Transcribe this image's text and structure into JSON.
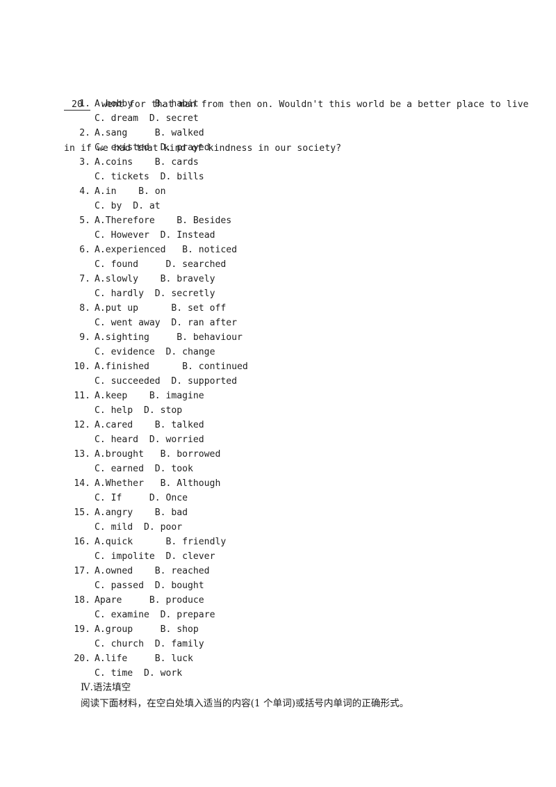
{
  "document": {
    "page_background": "#ffffff",
    "text_color": "#1d1d1d"
  },
  "passage": {
    "blank_number": "20",
    "line1_after_blank": "  went for that man from then on. Wouldn't this world be a better place to live",
    "line2": "in if we had that kind of kindness in our society?"
  },
  "cloze": {
    "items": [
      {
        "num": "1.",
        "a": "A.hobby",
        "b": "B. habit",
        "gap_ab": "    ",
        "c": "C. dream",
        "d": "D. secret",
        "gap_cd": "  ",
        "c_indent": "  "
      },
      {
        "num": "2.",
        "a": "A.sang",
        "b": "B. walked",
        "gap_ab": "     ",
        "c": "C. existed",
        "d": "D. prayed",
        "gap_cd": "  ",
        "c_indent": "  "
      },
      {
        "num": "3.",
        "a": "A.coins",
        "b": "B. cards",
        "gap_ab": "    ",
        "c": "C. tickets",
        "d": "D. bills",
        "gap_cd": "  ",
        "c_indent": "  "
      },
      {
        "num": "4.",
        "a": "A.in",
        "b": "B. on",
        "gap_ab": "    ",
        "c": "C. by",
        "d": "D. at",
        "gap_cd": "  ",
        "c_indent": " "
      },
      {
        "num": "5.",
        "a": "A.Therefore",
        "b": "B. Besides",
        "gap_ab": "    ",
        "c": "C. However",
        "d": "D. Instead",
        "gap_cd": "  ",
        "c_indent": "  "
      },
      {
        "num": "6.",
        "a": "A.experienced",
        "b": "B. noticed",
        "gap_ab": "   ",
        "c": "C. found",
        "d": "D. searched",
        "gap_cd": "     ",
        "c_indent": "  "
      },
      {
        "num": "7.",
        "a": "A.slowly",
        "b": "B. bravely",
        "gap_ab": "    ",
        "c": "C. hardly",
        "d": "D. secretly",
        "gap_cd": "  ",
        "c_indent": "  "
      },
      {
        "num": "8.",
        "a": "A.put up",
        "b": "B. set off",
        "gap_ab": "      ",
        "c": "C. went away",
        "d": "D. ran after",
        "gap_cd": "  ",
        "c_indent": "  "
      },
      {
        "num": "9.",
        "a": "A.sighting",
        "b": "B. behaviour",
        "gap_ab": "     ",
        "c": "C. evidence",
        "d": "D. change",
        "gap_cd": "  ",
        "c_indent": "  "
      },
      {
        "num": "10.",
        "a": "A.finished",
        "b": "B. continued",
        "gap_ab": "      ",
        "c": "C. succeeded",
        "d": "D. supported",
        "gap_cd": "  ",
        "c_indent": "  "
      },
      {
        "num": "11.",
        "a": "A.keep",
        "b": "B. imagine",
        "gap_ab": "    ",
        "c": "C. help",
        "d": "D. stop",
        "gap_cd": "  ",
        "c_indent": "  "
      },
      {
        "num": "12.",
        "a": "A.cared",
        "b": "B. talked",
        "gap_ab": "    ",
        "c": "C. heard",
        "d": "D. worried",
        "gap_cd": "  ",
        "c_indent": "  "
      },
      {
        "num": "13.",
        "a": "A.brought",
        "b": "B. borrowed",
        "gap_ab": "   ",
        "c": "C. earned",
        "d": "D. took",
        "gap_cd": "  ",
        "c_indent": "  "
      },
      {
        "num": "14.",
        "a": "A.Whether",
        "b": "B. Although",
        "gap_ab": "   ",
        "c": "C. If",
        "d": "D. Once",
        "gap_cd": "     ",
        "c_indent": "  "
      },
      {
        "num": "15.",
        "a": "A.angry",
        "b": "B. bad",
        "gap_ab": "    ",
        "c": "C. mild",
        "d": "D. poor",
        "gap_cd": "  ",
        "c_indent": "  "
      },
      {
        "num": "16.",
        "a": "A.quick",
        "b": "B. friendly",
        "gap_ab": "      ",
        "c": "C. impolite",
        "d": "D. clever",
        "gap_cd": "  ",
        "c_indent": "  "
      },
      {
        "num": "17.",
        "a": "A.owned",
        "b": "B. reached",
        "gap_ab": "    ",
        "c": "C. passed",
        "d": "D. bought",
        "gap_cd": "  ",
        "c_indent": "  "
      },
      {
        "num": "18.",
        "a": "Apare",
        "b": "B. produce",
        "gap_ab": "     ",
        "c": "C. examine",
        "d": "D. prepare",
        "gap_cd": "  ",
        "c_indent": "  "
      },
      {
        "num": "19.",
        "a": "A.group",
        "b": "B. shop",
        "gap_ab": "     ",
        "c": "C. church",
        "d": "D. family",
        "gap_cd": "  ",
        "c_indent": "  "
      },
      {
        "num": "20.",
        "a": "A.life",
        "b": "B. luck",
        "gap_ab": "     ",
        "c": "C. time",
        "d": "D. work",
        "gap_cd": "  ",
        "c_indent": "  "
      }
    ]
  },
  "grammar_section": {
    "heading": "Ⅳ.语法填空",
    "instruction": "阅读下面材料，在空白处填入适当的内容(1 个单词)或括号内单词的正确形式。"
  }
}
